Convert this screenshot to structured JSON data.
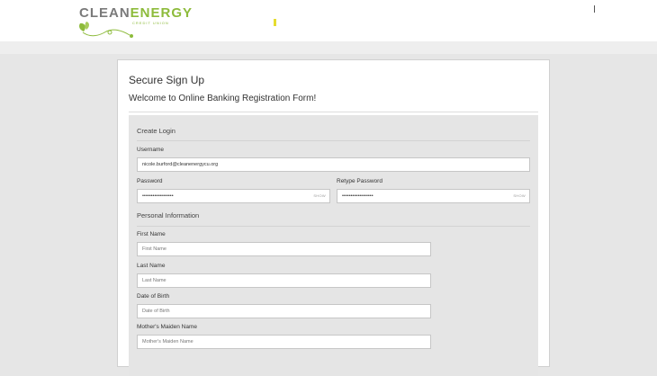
{
  "brand": {
    "name_part1": "CLEAN",
    "name_part2": "ENERGY",
    "tagline": "CREDIT UNION",
    "colors": {
      "gray": "#7a7a7a",
      "green": "#8dbb3b"
    }
  },
  "form": {
    "title": "Secure Sign Up",
    "subtitle": "Welcome to Online Banking Registration Form!",
    "sections": {
      "login": "Create Login",
      "personal": "Personal Information"
    },
    "username": {
      "label": "Username",
      "value": "nicole.burford@cleanenergycu.org"
    },
    "password": {
      "label": "Password",
      "value": "••••••••••••••••••",
      "show": "SHOW"
    },
    "retype_password": {
      "label": "Retype Password",
      "value": "••••••••••••••••••",
      "show": "SHOW"
    },
    "first_name": {
      "label": "First Name",
      "placeholder": "First Name"
    },
    "last_name": {
      "label": "Last Name",
      "placeholder": "Last Name"
    },
    "dob": {
      "label": "Date of Birth",
      "placeholder": "Date of Birth"
    },
    "maiden": {
      "label": "Mother's Maiden Name",
      "placeholder": "Mother's Maiden Name"
    }
  }
}
